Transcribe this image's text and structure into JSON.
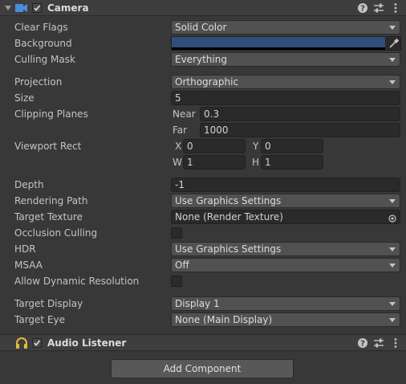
{
  "camera": {
    "title": "Camera",
    "enabled": true,
    "icons": [
      "camera-icon",
      "help-icon",
      "presets-icon",
      "more-icon"
    ]
  },
  "fields": {
    "clear_flags": {
      "label": "Clear Flags",
      "value": "Solid Color"
    },
    "background": {
      "label": "Background",
      "color": "#314D79"
    },
    "culling_mask": {
      "label": "Culling Mask",
      "value": "Everything"
    },
    "projection": {
      "label": "Projection",
      "value": "Orthographic"
    },
    "size": {
      "label": "Size",
      "value": "5"
    },
    "clipping_planes": {
      "label": "Clipping Planes",
      "near_label": "Near",
      "near": "0.3",
      "far_label": "Far",
      "far": "1000"
    },
    "viewport_rect": {
      "label": "Viewport Rect",
      "x_label": "X",
      "x": "0",
      "y_label": "Y",
      "y": "0",
      "w_label": "W",
      "w": "1",
      "h_label": "H",
      "h": "1"
    },
    "depth": {
      "label": "Depth",
      "value": "-1"
    },
    "rendering_path": {
      "label": "Rendering Path",
      "value": "Use Graphics Settings"
    },
    "target_texture": {
      "label": "Target Texture",
      "value": "None (Render Texture)"
    },
    "occlusion_culling": {
      "label": "Occlusion Culling",
      "checked": false
    },
    "hdr": {
      "label": "HDR",
      "value": "Use Graphics Settings"
    },
    "msaa": {
      "label": "MSAA",
      "value": "Off"
    },
    "allow_dynamic_resolution": {
      "label": "Allow Dynamic Resolution",
      "checked": false
    },
    "target_display": {
      "label": "Target Display",
      "value": "Display 1"
    },
    "target_eye": {
      "label": "Target Eye",
      "value": "None (Main Display)"
    }
  },
  "audio_listener": {
    "title": "Audio Listener",
    "enabled": true
  },
  "add_component": {
    "label": "Add Component"
  }
}
